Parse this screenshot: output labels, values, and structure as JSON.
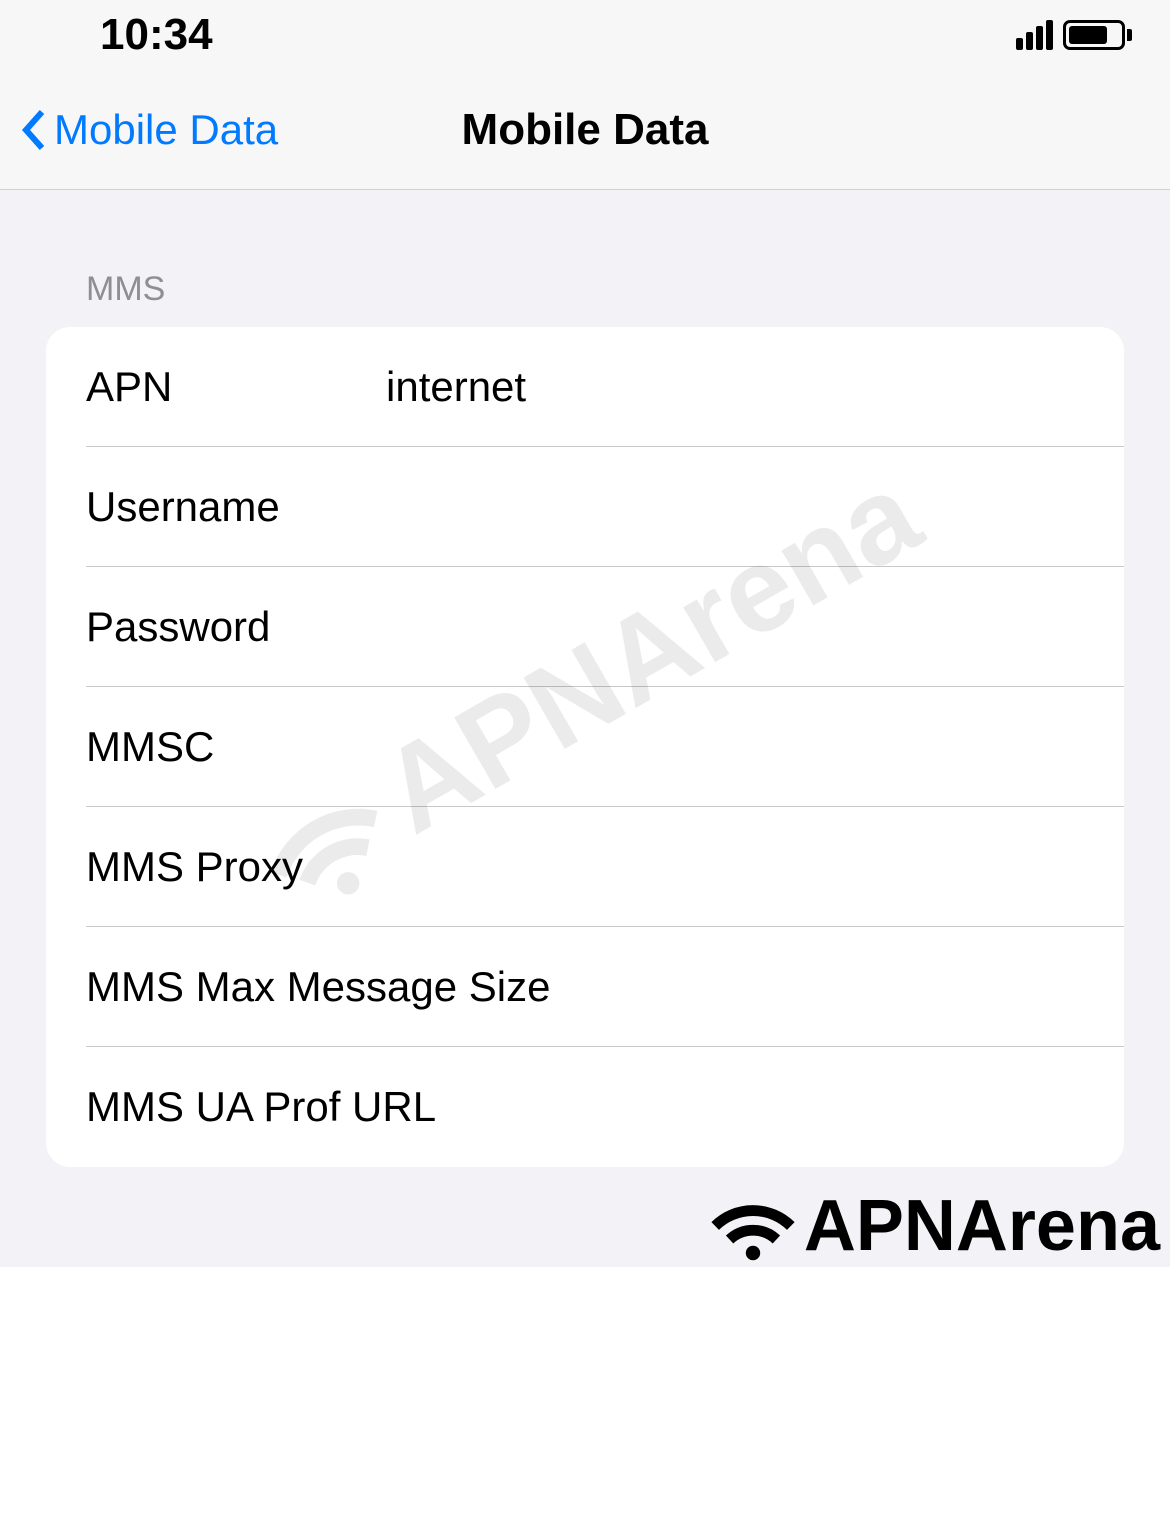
{
  "status": {
    "time": "10:34"
  },
  "nav": {
    "back_label": "Mobile Data",
    "title": "Mobile Data"
  },
  "section": {
    "header": "MMS"
  },
  "fields": {
    "apn": {
      "label": "APN",
      "value": "internet"
    },
    "username": {
      "label": "Username",
      "value": ""
    },
    "password": {
      "label": "Password",
      "value": ""
    },
    "mmsc": {
      "label": "MMSC",
      "value": ""
    },
    "mms_proxy": {
      "label": "MMS Proxy",
      "value": ""
    },
    "mms_max": {
      "label": "MMS Max Message Size",
      "value": ""
    },
    "mms_ua": {
      "label": "MMS UA Prof URL",
      "value": ""
    }
  },
  "brand": {
    "name": "APNArena"
  }
}
